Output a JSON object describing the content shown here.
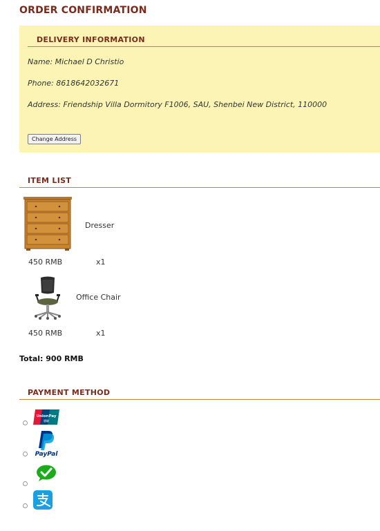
{
  "page": {
    "title": "ORDER CONFIRMATION"
  },
  "delivery": {
    "heading": "DELIVERY INFORMATION",
    "name": "Name: Michael D Christio",
    "phone": "Phone: 8618642032671",
    "address": "Address: Friendship Villa Dormitory F1006, SAU, Shenbei New District, 110000",
    "change_button": "Change Address"
  },
  "items": {
    "heading": "ITEM LIST",
    "list": [
      {
        "name": "Dresser",
        "price": "450 RMB",
        "qty": "x1",
        "icon": "dresser-icon"
      },
      {
        "name": "Office Chair",
        "price": "450 RMB",
        "qty": "x1",
        "icon": "office-chair-icon"
      }
    ],
    "total": "Total: 900 RMB"
  },
  "payment": {
    "heading": "PAYMENT METHOD",
    "methods": [
      {
        "label": "UnionPay",
        "icon": "unionpay-icon"
      },
      {
        "label": "PayPal",
        "icon": "paypal-icon"
      },
      {
        "label": "WeChat Pay",
        "icon": "wechat-pay-icon"
      },
      {
        "label": "Alipay",
        "icon": "alipay-icon"
      }
    ],
    "unionpay_text": "UnionPay",
    "paypal_text": "PayPal"
  },
  "colors": {
    "heading": "#7a2a1c",
    "rule": "#c87f3a",
    "delivery_bg": "#fbf4b5"
  }
}
